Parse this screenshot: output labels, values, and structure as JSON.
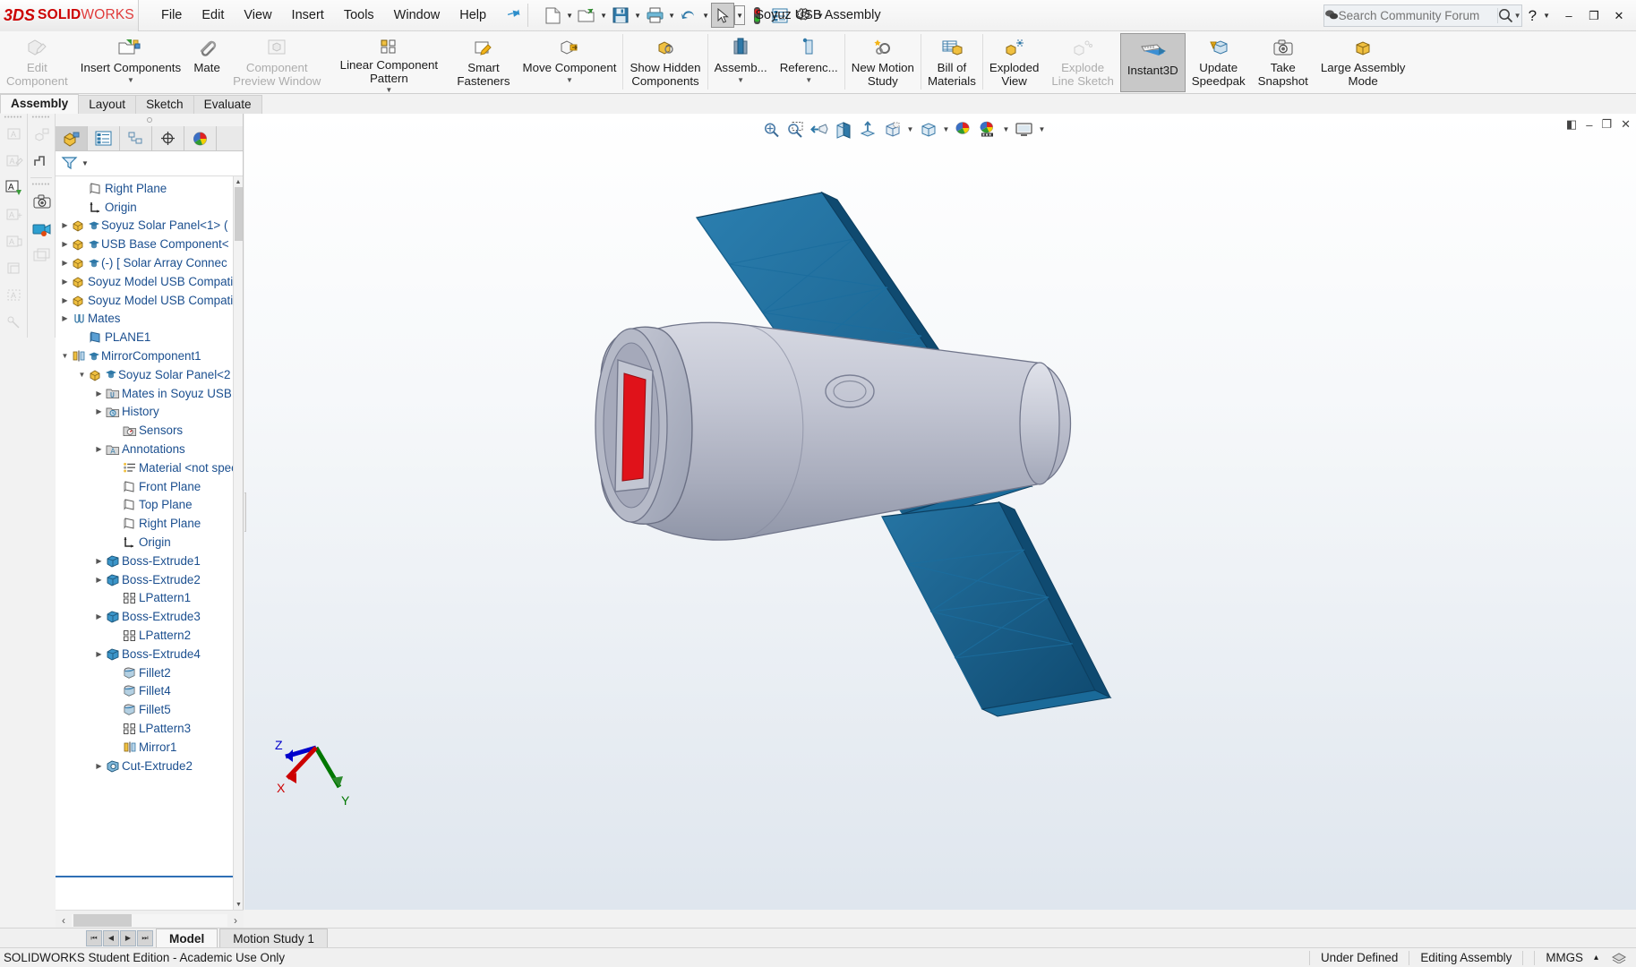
{
  "app": {
    "brand_3ds": "3DS",
    "brand_solid": "SOLID",
    "brand_works": "WORKS",
    "document_title": "Soyuz USB Assembly",
    "accent_red": "#cc0000",
    "accent_blue": "#1b4f8f",
    "panel_bg": "#f2f2f2"
  },
  "menubar": {
    "items": [
      {
        "label": "File"
      },
      {
        "label": "Edit"
      },
      {
        "label": "View"
      },
      {
        "label": "Insert"
      },
      {
        "label": "Tools"
      },
      {
        "label": "Window"
      },
      {
        "label": "Help"
      }
    ],
    "pin_icon": "pushpin-icon"
  },
  "quick_access": {
    "buttons": [
      {
        "name": "new-document",
        "icon": "new-document-icon",
        "has_caret": true
      },
      {
        "name": "open-document",
        "icon": "open-folder-icon",
        "has_caret": true
      },
      {
        "name": "save-document",
        "icon": "floppy-disk-icon",
        "has_caret": true
      },
      {
        "name": "print-document",
        "icon": "printer-icon",
        "has_caret": true
      },
      {
        "name": "undo",
        "icon": "undo-arrow-icon",
        "has_caret": true
      },
      {
        "name": "select",
        "icon": "cursor-arrow-icon",
        "has_caret": true
      },
      {
        "name": "rebuild",
        "icon": "traffic-light-icon",
        "has_caret": false
      },
      {
        "name": "file-properties",
        "icon": "properties-list-icon",
        "has_caret": false
      },
      {
        "name": "options",
        "icon": "gear-icon",
        "has_caret": true
      }
    ]
  },
  "search": {
    "placeholder": "Search Community Forum",
    "value": "",
    "left_icon": "forum-bubble-icon",
    "magnifier_icon": "magnifier-icon"
  },
  "window_controls": {
    "help": "?",
    "minimize": "–",
    "restore": "❐",
    "close": "✕"
  },
  "ribbon": {
    "buttons": [
      {
        "label": "Edit\nComponent",
        "icon": "edit-component-icon",
        "disabled": true,
        "caret": false,
        "active": false
      },
      {
        "label": "Insert Components",
        "icon": "insert-components-icon",
        "disabled": false,
        "caret": true,
        "active": false
      },
      {
        "label": "Mate",
        "icon": "mate-paperclip-icon",
        "disabled": false,
        "caret": false,
        "active": false
      },
      {
        "label": "Component\nPreview Window",
        "icon": "component-preview-icon",
        "disabled": true,
        "caret": false,
        "active": false
      },
      {
        "label": "Linear Component Pattern",
        "icon": "linear-pattern-icon",
        "disabled": false,
        "caret": true,
        "active": false
      },
      {
        "label": "Smart\nFasteners",
        "icon": "smart-fasteners-icon",
        "disabled": false,
        "caret": false,
        "active": false
      },
      {
        "label": "Move Component",
        "icon": "move-component-icon",
        "disabled": false,
        "caret": true,
        "active": false
      },
      {
        "sep": true
      },
      {
        "label": "Show Hidden\nComponents",
        "icon": "show-hidden-components-icon",
        "disabled": false,
        "caret": false,
        "active": false
      },
      {
        "sep": true
      },
      {
        "label": "Assemb...",
        "icon": "assembly-features-icon",
        "disabled": false,
        "caret": true,
        "active": false
      },
      {
        "label": "Referenc...",
        "icon": "reference-geometry-icon",
        "disabled": false,
        "caret": true,
        "active": false
      },
      {
        "sep": true
      },
      {
        "label": "New Motion\nStudy",
        "icon": "new-motion-study-icon",
        "disabled": false,
        "caret": false,
        "active": false
      },
      {
        "sep": true
      },
      {
        "label": "Bill of\nMaterials",
        "icon": "bill-of-materials-icon",
        "disabled": false,
        "caret": false,
        "active": false
      },
      {
        "sep": true
      },
      {
        "label": "Exploded\nView",
        "icon": "exploded-view-icon",
        "disabled": false,
        "caret": false,
        "active": false
      },
      {
        "label": "Explode\nLine Sketch",
        "icon": "explode-line-sketch-icon",
        "disabled": true,
        "caret": false,
        "active": false
      },
      {
        "label": "Instant3D",
        "icon": "instant3d-icon",
        "disabled": false,
        "caret": false,
        "active": true
      },
      {
        "label": "Update\nSpeedpak",
        "icon": "update-speedpak-icon",
        "disabled": false,
        "caret": false,
        "active": false
      },
      {
        "label": "Take\nSnapshot",
        "icon": "camera-icon",
        "disabled": false,
        "caret": false,
        "active": false
      },
      {
        "label": "Large Assembly\nMode",
        "icon": "large-assembly-mode-icon",
        "disabled": false,
        "caret": false,
        "active": false
      }
    ]
  },
  "command_tabs": [
    {
      "label": "Assembly",
      "selected": true
    },
    {
      "label": "Layout",
      "selected": false
    },
    {
      "label": "Sketch",
      "selected": false
    },
    {
      "label": "Evaluate",
      "selected": false
    }
  ],
  "left_strip_a": [
    {
      "name": "auto-balloon-icon",
      "disabled": true
    },
    {
      "name": "note-icon",
      "disabled": true
    },
    {
      "name": "surface-finish-icon",
      "disabled": false
    },
    {
      "name": "add-annotation-icon",
      "disabled": true
    },
    {
      "name": "datum-feature-icon",
      "disabled": true
    },
    {
      "name": "block-icon",
      "disabled": true
    },
    {
      "name": "area-hatch-icon",
      "disabled": true
    },
    {
      "name": "weld-bead-icon",
      "disabled": true
    }
  ],
  "left_strip_b": [
    {
      "name": "assembly-feature-icon",
      "disabled": true
    },
    {
      "name": "step-icon",
      "disabled": true
    },
    {
      "name": "camera-icon",
      "disabled": false
    },
    {
      "name": "motion-capture-icon",
      "disabled": false
    },
    {
      "name": "copy-view-icon",
      "disabled": true
    }
  ],
  "tree_panel": {
    "tabs": [
      {
        "name": "feature-manager-tab",
        "icon": "yellow-cube-icon",
        "selected": true
      },
      {
        "name": "property-manager-tab",
        "icon": "property-list-icon",
        "selected": false
      },
      {
        "name": "configuration-manager-tab",
        "icon": "configuration-icon",
        "selected": false
      },
      {
        "name": "dimxpert-manager-tab",
        "icon": "dimxpert-target-icon",
        "selected": false
      },
      {
        "name": "display-manager-tab",
        "icon": "color-sphere-icon",
        "selected": false
      }
    ],
    "filter_icon": "filter-funnel-icon",
    "items": [
      {
        "label": "Right Plane",
        "indent": 1,
        "expand": "none",
        "icon": "plane-icon"
      },
      {
        "label": "Origin",
        "indent": 1,
        "expand": "none",
        "icon": "origin-icon"
      },
      {
        "label": "Soyuz Solar Panel<1> (",
        "indent": 0,
        "expand": "collapsed",
        "icon": "component-icon",
        "badge": "student-cap-icon"
      },
      {
        "label": "USB Base Component<",
        "indent": 0,
        "expand": "collapsed",
        "icon": "component-icon",
        "badge": "student-cap-icon"
      },
      {
        "label": "(-) [ Solar Array Connec",
        "indent": 0,
        "expand": "collapsed",
        "icon": "component-icon",
        "badge": "student-cap-icon"
      },
      {
        "label": "Soyuz Model USB Compati",
        "indent": 0,
        "expand": "collapsed",
        "icon": "component-icon"
      },
      {
        "label": "Soyuz Model USB Compati",
        "indent": 0,
        "expand": "collapsed",
        "icon": "component-icon"
      },
      {
        "label": "Mates",
        "indent": 0,
        "expand": "collapsed",
        "icon": "mates-icon"
      },
      {
        "label": "PLANE1",
        "indent": 1,
        "expand": "none",
        "icon": "plane-blue-icon"
      },
      {
        "label": "MirrorComponent1",
        "indent": 0,
        "expand": "expanded",
        "icon": "mirror-icon",
        "badge": "student-cap-icon"
      },
      {
        "label": "Soyuz Solar Panel<2",
        "indent": 1,
        "expand": "expanded",
        "icon": "component-icon",
        "badge": "student-cap-icon"
      },
      {
        "label": "Mates in Soyuz USB",
        "indent": 2,
        "expand": "collapsed",
        "icon": "folder-mates-icon"
      },
      {
        "label": "History",
        "indent": 2,
        "expand": "collapsed",
        "icon": "folder-history-icon"
      },
      {
        "label": "Sensors",
        "indent": 3,
        "expand": "none",
        "icon": "folder-sensors-icon"
      },
      {
        "label": "Annotations",
        "indent": 2,
        "expand": "collapsed",
        "icon": "folder-annotations-icon"
      },
      {
        "label": "Material <not specif",
        "indent": 3,
        "expand": "none",
        "icon": "material-icon"
      },
      {
        "label": "Front Plane",
        "indent": 3,
        "expand": "none",
        "icon": "plane-icon"
      },
      {
        "label": "Top Plane",
        "indent": 3,
        "expand": "none",
        "icon": "plane-icon"
      },
      {
        "label": "Right Plane",
        "indent": 3,
        "expand": "none",
        "icon": "plane-icon"
      },
      {
        "label": "Origin",
        "indent": 3,
        "expand": "none",
        "icon": "origin-icon"
      },
      {
        "label": "Boss-Extrude1",
        "indent": 2,
        "expand": "collapsed",
        "icon": "boss-extrude-icon"
      },
      {
        "label": "Boss-Extrude2",
        "indent": 2,
        "expand": "collapsed",
        "icon": "boss-extrude-icon"
      },
      {
        "label": "LPattern1",
        "indent": 3,
        "expand": "none",
        "icon": "lpattern-icon"
      },
      {
        "label": "Boss-Extrude3",
        "indent": 2,
        "expand": "collapsed",
        "icon": "boss-extrude-icon"
      },
      {
        "label": "LPattern2",
        "indent": 3,
        "expand": "none",
        "icon": "lpattern-icon"
      },
      {
        "label": "Boss-Extrude4",
        "indent": 2,
        "expand": "collapsed",
        "icon": "boss-extrude-icon"
      },
      {
        "label": "Fillet2",
        "indent": 3,
        "expand": "none",
        "icon": "fillet-icon"
      },
      {
        "label": "Fillet4",
        "indent": 3,
        "expand": "none",
        "icon": "fillet-icon"
      },
      {
        "label": "Fillet5",
        "indent": 3,
        "expand": "none",
        "icon": "fillet-icon"
      },
      {
        "label": "LPattern3",
        "indent": 3,
        "expand": "none",
        "icon": "lpattern-icon"
      },
      {
        "label": "Mirror1",
        "indent": 3,
        "expand": "none",
        "icon": "mirror-icon"
      },
      {
        "label": "Cut-Extrude2",
        "indent": 2,
        "expand": "collapsed",
        "icon": "cut-extrude-icon"
      }
    ]
  },
  "viewport": {
    "hud_buttons": [
      {
        "name": "zoom-to-fit-icon",
        "caret": false
      },
      {
        "name": "zoom-to-area-icon",
        "caret": false
      },
      {
        "name": "previous-view-icon",
        "caret": false
      },
      {
        "name": "section-view-icon",
        "caret": false
      },
      {
        "name": "view-orientation-icon",
        "caret": false
      },
      {
        "name": "display-style-icon",
        "caret": true
      },
      {
        "name": "hide-show-items-icon",
        "caret": true
      },
      {
        "name": "edit-appearance-icon",
        "caret": false
      },
      {
        "name": "apply-scene-icon",
        "caret": true
      },
      {
        "name": "view-settings-icon",
        "caret": true
      }
    ],
    "panel_controls": [
      {
        "name": "collapse-panel-icon",
        "glyph": "◧"
      },
      {
        "name": "minimize-view-icon",
        "glyph": "–"
      },
      {
        "name": "restore-view-icon",
        "glyph": "❐"
      },
      {
        "name": "close-view-icon",
        "glyph": "✕"
      }
    ],
    "triad": {
      "x": "X",
      "y": "Y",
      "z": "Z",
      "x_color": "#cc0000",
      "y_color": "#007700",
      "z_color": "#0000cc"
    },
    "model": {
      "body_color": "#b9bcc9",
      "panel_color": "#1b5f8c",
      "accent_color": "#e01010"
    }
  },
  "bottom": {
    "nav_buttons": [
      "⏮",
      "◀",
      "▶",
      "⏭"
    ],
    "tabs": [
      {
        "label": "Model",
        "selected": true
      },
      {
        "label": "Motion Study 1",
        "selected": false
      }
    ],
    "hscroll": {
      "left": "‹",
      "right": "›"
    }
  },
  "statusbar": {
    "license": "SOLIDWORKS Student Edition - Academic Use Only",
    "state": "Under Defined",
    "mode": "Editing Assembly",
    "units": "MMGS",
    "units_caret": "▴",
    "overlay_icon": "layers-icon"
  }
}
